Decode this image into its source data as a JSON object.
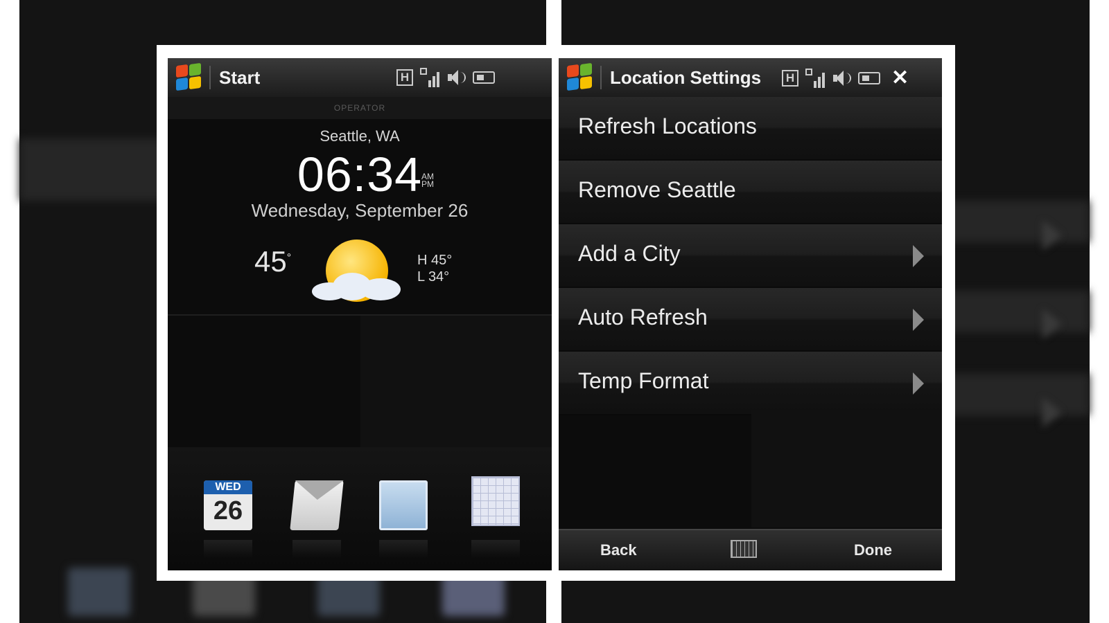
{
  "left_screen": {
    "title": "Start",
    "operator": "OPERATOR",
    "status_icons": [
      "h-icon",
      "signal-icon",
      "volume-icon",
      "battery-icon"
    ],
    "location": "Seattle, WA",
    "time": "06:34",
    "am": "AM",
    "pm": "PM",
    "date": "Wednesday, September 26",
    "temperature": "45",
    "degree": "°",
    "high": "H 45°",
    "low": "L 34°",
    "weather_icon": "sun-cloud-icon",
    "dock": {
      "calendar_weekday": "WED",
      "calendar_day": "26",
      "icons": [
        "calendar-icon",
        "messaging-icon",
        "pictures-icon",
        "grid-calendar-icon"
      ]
    }
  },
  "right_screen": {
    "title": "Location Settings",
    "status_icons": [
      "h-icon",
      "signal-icon",
      "volume-icon",
      "battery-icon",
      "close-icon"
    ],
    "close_glyph": "✕",
    "menu": [
      {
        "label": "Refresh Locations",
        "has_submenu": false
      },
      {
        "label": "Remove Seattle",
        "has_submenu": false
      },
      {
        "label": "Add a City",
        "has_submenu": true
      },
      {
        "label": "Auto Refresh",
        "has_submenu": true
      },
      {
        "label": "Temp Format",
        "has_submenu": true
      }
    ],
    "softkeys": {
      "left": "Back",
      "right": "Done",
      "center_icon": "keyboard-icon"
    }
  },
  "colors": {
    "accent_blue": "#1d5fae",
    "sun": "#f6b300",
    "background": "#0c0c0c"
  }
}
